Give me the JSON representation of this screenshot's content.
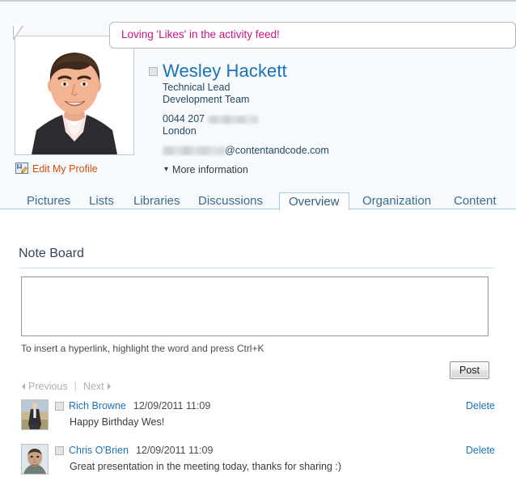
{
  "callout": {
    "text": "Loving 'Likes' in the activity feed!",
    "color": "#c71585"
  },
  "profile": {
    "photo_alt": "profile-photo",
    "edit_link": "Edit My Profile",
    "edit_link_color": "#d74e09",
    "name": "Wesley Hackett",
    "name_color": "#1a72b8",
    "job_title": "Technical Lead",
    "department": "Development Team",
    "phone_prefix": "0044 207",
    "phone_redacted": true,
    "location": "London",
    "email_local_redacted": true,
    "email_domain": "@contentandcode.com",
    "more_information": "More information",
    "more_information_chevron": "chevron-down-icon"
  },
  "tabs": [
    {
      "label": "Pictures",
      "active": false
    },
    {
      "label": "Lists",
      "active": false
    },
    {
      "label": "Libraries",
      "active": false
    },
    {
      "label": "Discussions",
      "active": false
    },
    {
      "label": "Overview",
      "active": true
    },
    {
      "label": "Organization",
      "active": false
    },
    {
      "label": "Content",
      "active": false
    }
  ],
  "note_board": {
    "title": "Note Board",
    "input_value": "",
    "input_placeholder": "",
    "hint": "To insert a hyperlink, highlight the word and press Ctrl+K",
    "post_label": "Post",
    "pager": {
      "previous": "Previous",
      "separator": "|",
      "next": "Next"
    },
    "delete_label": "Delete",
    "notes": [
      {
        "author": "Rich Browne",
        "date": "12/09/2011 11:09",
        "body": "Happy Birthday Wes!",
        "avatar": "avatar-rich-browne",
        "delete": "Delete"
      },
      {
        "author": "Chris O'Brien",
        "date": "12/09/2011 11:09",
        "body": "Great presentation in the meeting today, thanks for sharing :)",
        "avatar": "avatar-chris-obrien",
        "delete": "Delete"
      }
    ]
  },
  "colors": {
    "accent_blue": "#1a72b8",
    "tab_border": "#9ecfe8",
    "page_tint": "#f6fafd"
  }
}
